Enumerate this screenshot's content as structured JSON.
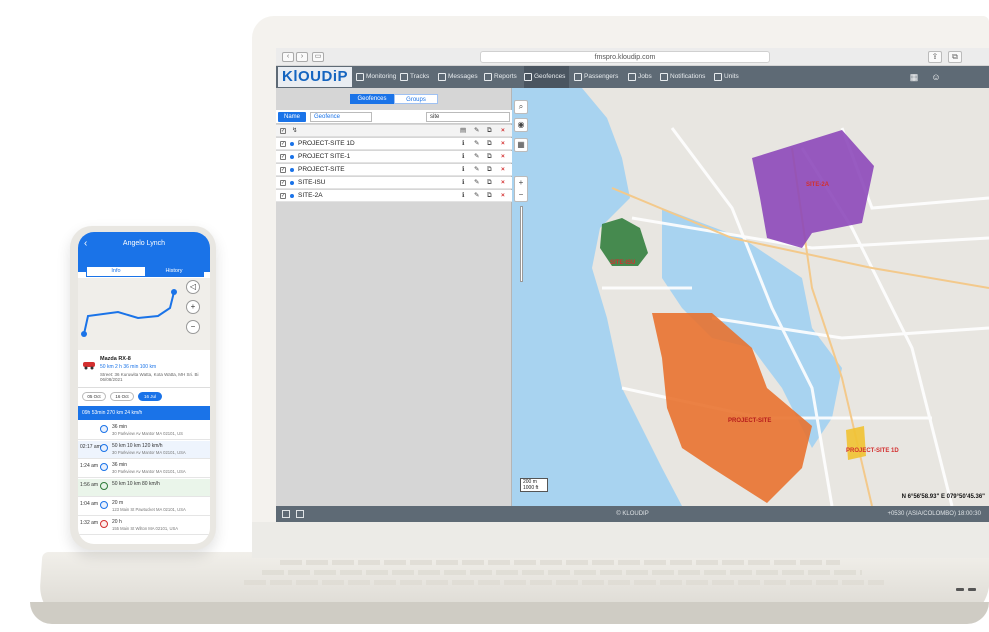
{
  "browser": {
    "url": "fmspro.kloudip.com",
    "nav_back": "‹",
    "nav_forward": "›"
  },
  "app": {
    "logo": "KlOUDiP",
    "nav": [
      {
        "label": "Monitoring"
      },
      {
        "label": "Tracks"
      },
      {
        "label": "Messages"
      },
      {
        "label": "Reports"
      },
      {
        "label": "Geofences"
      },
      {
        "label": "Passengers"
      },
      {
        "label": "Jobs"
      },
      {
        "label": "Notifications"
      },
      {
        "label": "Units"
      }
    ]
  },
  "panel": {
    "tabs": {
      "geofences": "Geofences",
      "groups": "Groups"
    },
    "filter_chip": "Name",
    "select_value": "Geofence",
    "search_value": "site",
    "rows": [
      {
        "name": "PROJECT-SITE 1D"
      },
      {
        "name": "PROJECT SITE-1"
      },
      {
        "name": "PROJECT-SITE"
      },
      {
        "name": "SITE-ISU"
      },
      {
        "name": "SITE-2A"
      }
    ]
  },
  "map": {
    "zones": [
      {
        "label": "SITE-2A",
        "color": "#8a44b8"
      },
      {
        "label": "SITE-ISU",
        "color": "#2f7d3a"
      },
      {
        "label": "PROJECT-SITE",
        "color": "#e8702a"
      },
      {
        "label": "PROJECT-SITE 1D",
        "color": "#f1c232"
      }
    ],
    "scale": "200 m",
    "scale2": "1000 ft",
    "coords": "N 6°56'58.93\" E 079°50'45.36\""
  },
  "statusbar": {
    "center": "© KLOUDIP",
    "right": "+0530 (ASIA/COLOMBO) 18:00:30"
  },
  "phone": {
    "title": "Angelo Lynch",
    "tab_left": "Info",
    "tab_right": "History",
    "unit_name": "Mazda RX-8",
    "unit_stats": "50 km  2 h 36 min  100 km",
    "address": "Street: 36 Kuruwita Watta, Kota Watta, MH Sri. Bi 06/08/2021",
    "chips": [
      "05 Oct",
      "16 Oct",
      "16 Jul"
    ],
    "bluebar": "09h 53min  270 km  24 km/h",
    "entries": [
      {
        "time": "",
        "values": "36 min",
        "addr": "30 Parkview Av Mantor MA 02101, US"
      },
      {
        "time": "02:17 am",
        "values": "50 km  10 km  120 km/h",
        "addr": "30 Parkview Av Mantor MA 02101, USA"
      },
      {
        "time": "1:24 am",
        "values": "36 min",
        "addr": "30 Parkview Av Mantor MA 02101, USA"
      },
      {
        "time": "1:56 am",
        "values": "50 km  10 km  80 km/h",
        "addr": ""
      },
      {
        "time": "1:04 am",
        "values": "20 m",
        "addr": "123 Main St Pawtucket MA 02101, USA"
      },
      {
        "time": "1:32 am",
        "values": "20 h",
        "addr": "155 Main St Wilton MA 02101, USA"
      }
    ]
  }
}
